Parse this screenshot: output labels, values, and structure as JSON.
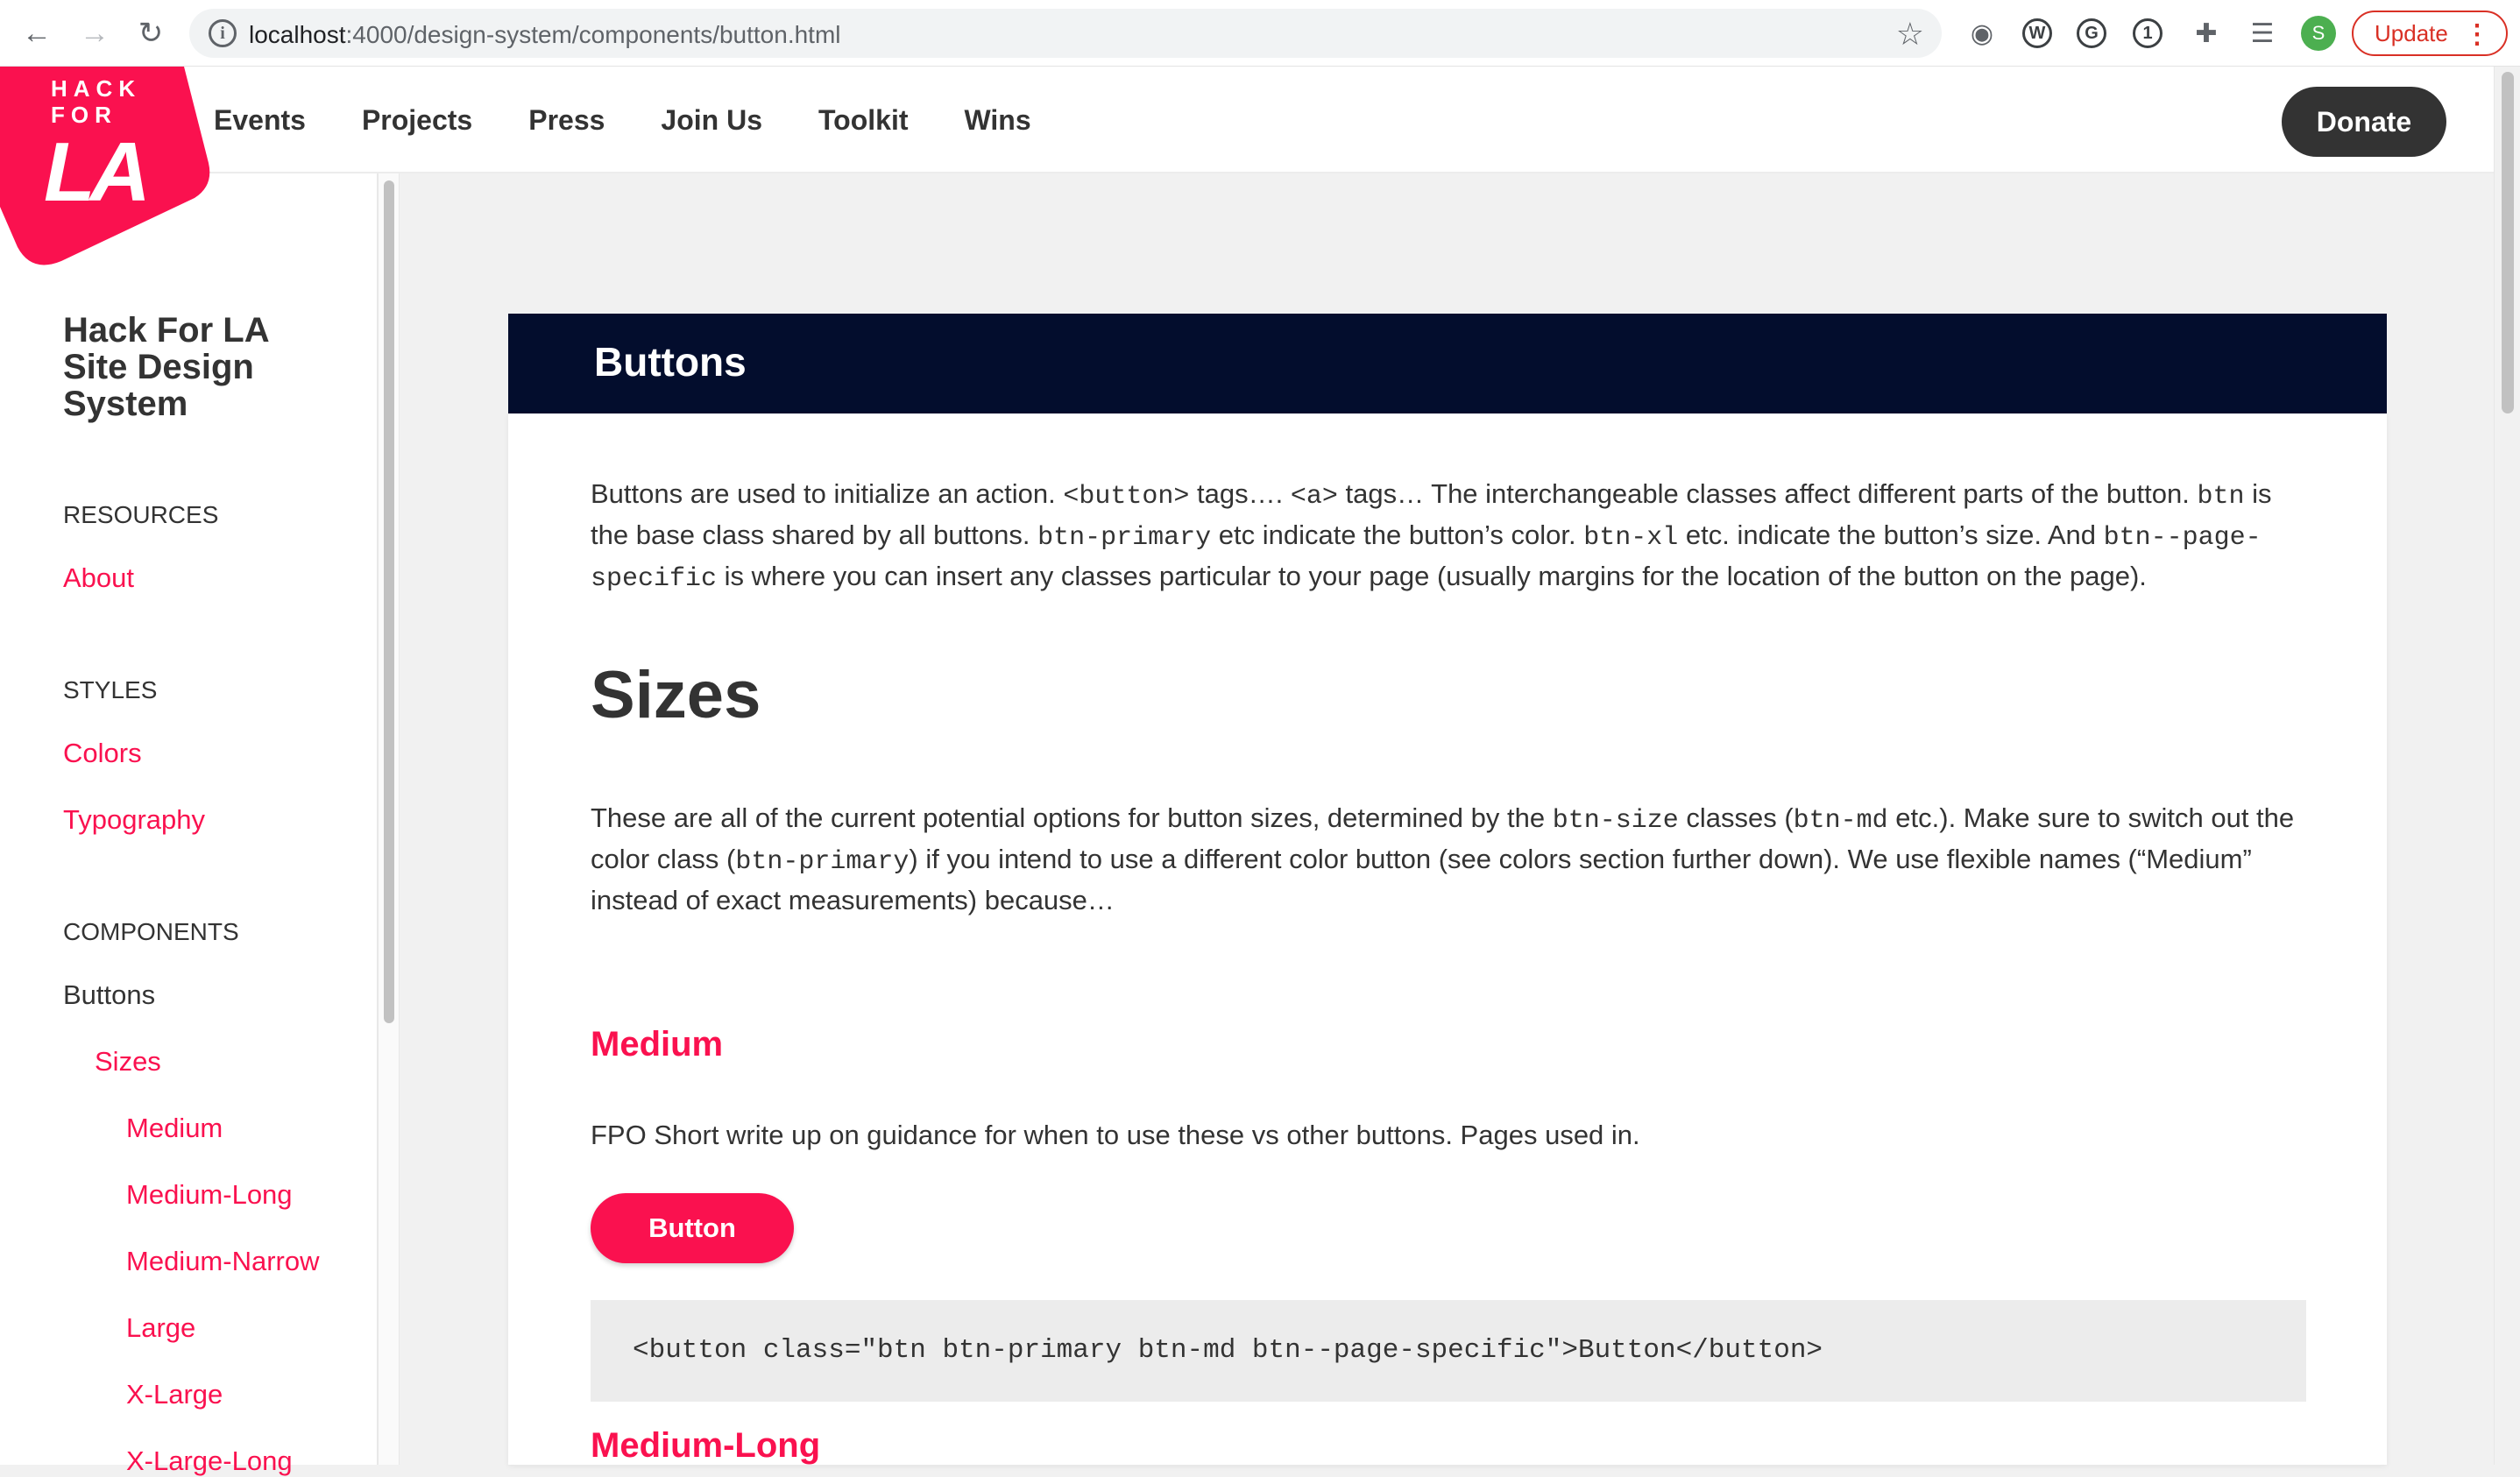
{
  "browser": {
    "url_host": "localhost",
    "url_rest": ":4000/design-system/components/button.html",
    "profile_initial": "S",
    "update_label": "Update"
  },
  "site": {
    "logo_line1": "HACK",
    "logo_line2": "FOR",
    "logo_la": "LA",
    "nav": [
      "Events",
      "Projects",
      "Press",
      "Join Us",
      "Toolkit",
      "Wins"
    ],
    "donate_label": "Donate"
  },
  "sidebar": {
    "title": "Hack For LA Site Design System",
    "resources_heading": "RESOURCES",
    "about": "About",
    "styles_heading": "STYLES",
    "colors": "Colors",
    "typography": "Typography",
    "components_heading": "COMPONENTS",
    "buttons": "Buttons",
    "sizes": "Sizes",
    "medium": "Medium",
    "medium_long": "Medium-Long",
    "medium_narrow": "Medium-Narrow",
    "large": "Large",
    "x_large": "X-Large",
    "x_large_long": "X-Large-Long"
  },
  "main": {
    "title": "Buttons",
    "intro": {
      "t1": "Buttons are used to initialize an action. ",
      "c1": "<button>",
      "t2": " tags…. ",
      "c2": "<a>",
      "t3": " tags… The interchangeable classes affect different parts of the button. ",
      "c3": "btn",
      "t4": " is the base class shared by all buttons. ",
      "c4": "btn-primary",
      "t5": " etc indicate the button’s color. ",
      "c5": "btn-xl",
      "t6": " etc. indicate the button’s size. And ",
      "c6": "btn--page-specific",
      "t7": " is where you can insert any classes particular to your page (usually margins for the location of the button on the page)."
    },
    "sizes_heading": "Sizes",
    "sizes_text": {
      "t1": "These are all of the current potential options for button sizes, determined by the ",
      "c1": "btn-size",
      "t2": " classes (",
      "c2": "btn-md",
      "t3": " etc.). Make sure to switch out the color class (",
      "c3": "btn-primary",
      "t4": ") if you intend to use a different color button (see colors section further down). We use flexible names (“Medium” instead of exact measurements) because…"
    },
    "medium_heading": "Medium",
    "medium_text": "FPO Short write up on guidance for when to use these vs other buttons. Pages used in.",
    "demo_button": "Button",
    "code_sample": "<button class=\"btn btn-primary btn-md btn--page-specific\">Button</button>",
    "medium_long_heading": "Medium-Long"
  },
  "colors": {
    "accent": "#fa114f",
    "header_bg": "#030d2d",
    "donate_bg": "#333333"
  }
}
